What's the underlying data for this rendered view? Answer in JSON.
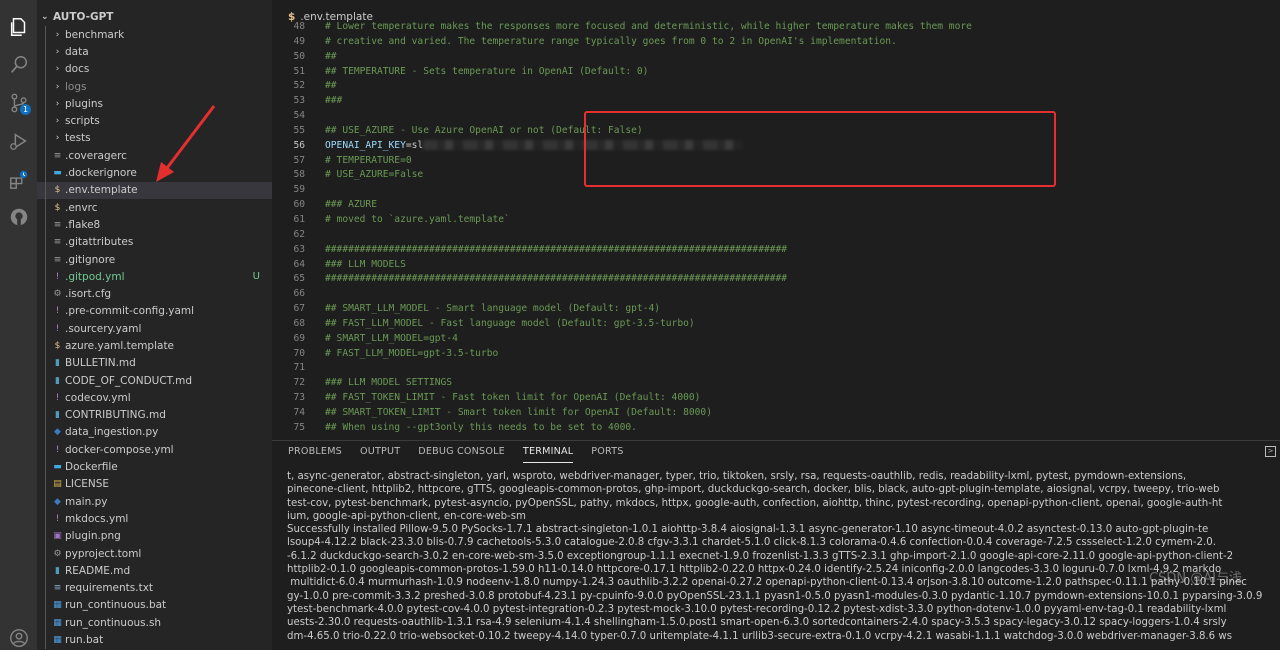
{
  "explorer": {
    "root": "AUTO-GPT",
    "items": [
      {
        "name": "benchmark",
        "type": "folder"
      },
      {
        "name": "data",
        "type": "folder"
      },
      {
        "name": "docs",
        "type": "folder"
      },
      {
        "name": "logs",
        "type": "folder-dim"
      },
      {
        "name": "plugins",
        "type": "folder"
      },
      {
        "name": "scripts",
        "type": "folder"
      },
      {
        "name": "tests",
        "type": "folder"
      },
      {
        "name": ".coveragerc",
        "type": "file"
      },
      {
        "name": ".dockerignore",
        "type": "file"
      },
      {
        "name": ".env.template",
        "type": "file"
      },
      {
        "name": ".envrc",
        "type": "file"
      },
      {
        "name": ".flake8",
        "type": "file"
      },
      {
        "name": ".gitattributes",
        "type": "file"
      },
      {
        "name": ".gitignore",
        "type": "file"
      },
      {
        "name": ".gitpod.yml",
        "type": "file",
        "git_status": "U"
      },
      {
        "name": ".isort.cfg",
        "type": "file"
      },
      {
        "name": ".pre-commit-config.yaml",
        "type": "file"
      },
      {
        "name": ".sourcery.yaml",
        "type": "file"
      },
      {
        "name": "azure.yaml.template",
        "type": "file"
      },
      {
        "name": "BULLETIN.md",
        "type": "file"
      },
      {
        "name": "CODE_OF_CONDUCT.md",
        "type": "file"
      },
      {
        "name": "codecov.yml",
        "type": "file"
      },
      {
        "name": "CONTRIBUTING.md",
        "type": "file"
      },
      {
        "name": "data_ingestion.py",
        "type": "file"
      },
      {
        "name": "docker-compose.yml",
        "type": "file"
      },
      {
        "name": "Dockerfile",
        "type": "file"
      },
      {
        "name": "LICENSE",
        "type": "file"
      },
      {
        "name": "main.py",
        "type": "file"
      },
      {
        "name": "mkdocs.yml",
        "type": "file"
      },
      {
        "name": "plugin.png",
        "type": "file"
      },
      {
        "name": "pyproject.toml",
        "type": "file"
      },
      {
        "name": "README.md",
        "type": "file"
      },
      {
        "name": "requirements.txt",
        "type": "file"
      },
      {
        "name": "run_continuous.bat",
        "type": "file"
      },
      {
        "name": "run_continuous.sh",
        "type": "file"
      },
      {
        "name": "run.bat",
        "type": "file"
      }
    ],
    "selected": ".env.template"
  },
  "activity": {
    "source_control_badge": "1"
  },
  "editor": {
    "breadcrumb_icon": "$",
    "breadcrumb": ".env.template",
    "active_line": "56",
    "lines": [
      {
        "n": "48",
        "text": "# Lower temperature makes the responses more focused and deterministic, while higher temperature makes them more",
        "kind": "comment"
      },
      {
        "n": "49",
        "text": "# creative and varied. The temperature range typically goes from 0 to 2 in OpenAI's implementation.",
        "kind": "comment"
      },
      {
        "n": "50",
        "text": "##",
        "kind": "comment"
      },
      {
        "n": "51",
        "text": "## TEMPERATURE - Sets temperature in OpenAI (Default: 0)",
        "kind": "comment"
      },
      {
        "n": "52",
        "text": "##",
        "kind": "comment"
      },
      {
        "n": "53",
        "text": "###",
        "kind": "comment"
      },
      {
        "n": "54",
        "text": "",
        "kind": "blank"
      },
      {
        "n": "55",
        "text": "## USE_AZURE - Use Azure OpenAI or not (Default: False)",
        "kind": "comment"
      },
      {
        "n": "56",
        "key": "OPENAI_API_KEY",
        "eq": "=",
        "value": "sl",
        "kind": "assign"
      },
      {
        "n": "57",
        "text": "# TEMPERATURE=0",
        "kind": "comment"
      },
      {
        "n": "58",
        "text": "# USE_AZURE=False",
        "kind": "comment"
      },
      {
        "n": "59",
        "text": "",
        "kind": "blank"
      },
      {
        "n": "60",
        "text": "### AZURE",
        "kind": "comment"
      },
      {
        "n": "61",
        "text": "# moved to `azure.yaml.template`",
        "kind": "comment"
      },
      {
        "n": "62",
        "text": "",
        "kind": "blank"
      },
      {
        "n": "63",
        "text": "################################################################################",
        "kind": "comment"
      },
      {
        "n": "64",
        "text": "### LLM MODELS",
        "kind": "comment"
      },
      {
        "n": "65",
        "text": "################################################################################",
        "kind": "comment"
      },
      {
        "n": "66",
        "text": "",
        "kind": "blank"
      },
      {
        "n": "67",
        "text": "## SMART_LLM_MODEL - Smart language model (Default: gpt-4)",
        "kind": "comment"
      },
      {
        "n": "68",
        "text": "## FAST_LLM_MODEL - Fast language model (Default: gpt-3.5-turbo)",
        "kind": "comment"
      },
      {
        "n": "69",
        "text": "# SMART_LLM_MODEL=gpt-4",
        "kind": "comment"
      },
      {
        "n": "70",
        "text": "# FAST_LLM_MODEL=gpt-3.5-turbo",
        "kind": "comment"
      },
      {
        "n": "71",
        "text": "",
        "kind": "blank"
      },
      {
        "n": "72",
        "text": "### LLM MODEL SETTINGS",
        "kind": "comment"
      },
      {
        "n": "73",
        "text": "## FAST_TOKEN_LIMIT - Fast token limit for OpenAI (Default: 4000)",
        "kind": "comment"
      },
      {
        "n": "74",
        "text": "## SMART_TOKEN_LIMIT - Smart token limit for OpenAI (Default: 8000)",
        "kind": "comment"
      },
      {
        "n": "75",
        "text": "## When using --gpt3only this needs to be set to 4000.",
        "kind": "comment"
      }
    ]
  },
  "panel": {
    "tabs": [
      "PROBLEMS",
      "OUTPUT",
      "DEBUG CONSOLE",
      "TERMINAL",
      "PORTS"
    ],
    "active_tab": "TERMINAL",
    "terminal_lines": [
      "t, async-generator, abstract-singleton, yarl, wsproto, webdriver-manager, typer, trio, tiktoken, srsly, rsa, requests-oauthlib, redis, readability-lxml, pytest, pymdown-extensions, ",
      "pinecone-client, httplib2, httpcore, gTTS, googleapis-common-protos, ghp-import, duckduckgo-search, docker, blis, black, auto-gpt-plugin-template, aiosignal, vcrpy, tweepy, trio-web",
      "test-cov, pytest-benchmark, pytest-asyncio, pyOpenSSL, pathy, mkdocs, httpx, google-auth, confection, aiohttp, thinc, pytest-recording, openapi-python-client, openai, google-auth-ht",
      "ium, google-api-python-client, en-core-web-sm",
      "Successfully installed Pillow-9.5.0 PySocks-1.7.1 abstract-singleton-1.0.1 aiohttp-3.8.4 aiosignal-1.3.1 async-generator-1.10 async-timeout-4.0.2 asynctest-0.13.0 auto-gpt-plugin-te",
      "lsoup4-4.12.2 black-23.3.0 blis-0.7.9 cachetools-5.3.0 catalogue-2.0.8 cfgv-3.3.1 chardet-5.1.0 click-8.1.3 colorama-0.4.6 confection-0.0.4 coverage-7.2.5 cssselect-1.2.0 cymem-2.0.",
      "-6.1.2 duckduckgo-search-3.0.2 en-core-web-sm-3.5.0 exceptiongroup-1.1.1 execnet-1.9.0 frozenlist-1.3.3 gTTS-2.3.1 ghp-import-2.1.0 google-api-core-2.11.0 google-api-python-client-2",
      "httplib2-0.1.0 googleapis-common-protos-1.59.0 h11-0.14.0 httpcore-0.17.1 httplib2-0.22.0 httpx-0.24.0 identify-2.5.24 iniconfig-2.0.0 langcodes-3.3.0 loguru-0.7.0 lxml-4.9.2 markdo",
      " multidict-6.0.4 murmurhash-1.0.9 nodeenv-1.8.0 numpy-1.24.3 oauthlib-3.2.2 openai-0.27.2 openapi-python-client-0.13.4 orjson-3.8.10 outcome-1.2.0 pathspec-0.11.1 pathy-0.10.1 pinec",
      "gy-1.0.0 pre-commit-3.3.2 preshed-3.0.8 protobuf-4.23.1 py-cpuinfo-9.0.0 pyOpenSSL-23.1.1 pyasn1-0.5.0 pyasn1-modules-0.3.0 pydantic-1.10.7 pymdown-extensions-10.0.1 pyparsing-3.0.9",
      "ytest-benchmark-4.0.0 pytest-cov-4.0.0 pytest-integration-0.2.3 pytest-mock-3.10.0 pytest-recording-0.12.2 pytest-xdist-3.3.0 python-dotenv-1.0.0 pyyaml-env-tag-0.1 readability-lxml",
      "uests-2.30.0 requests-oauthlib-1.3.1 rsa-4.9 selenium-4.1.4 shellingham-1.5.0.post1 smart-open-6.3.0 sortedcontainers-2.4.0 spacy-3.5.3 spacy-legacy-3.0.12 spacy-loggers-1.0.4 srsly",
      "dm-4.65.0 trio-0.22.0 trio-websocket-0.10.2 tweepy-4.14.0 typer-0.7.0 uritemplate-4.1.1 urllib3-secure-extra-0.1.0 vcrpy-4.2.1 wasabi-1.1.1 watchdog-3.0.0 webdriver-manager-3.8.6 ws"
    ],
    "maximize_icon": ">",
    "watermark": "CSDN @AI与浅"
  },
  "colors": {
    "highlight_box": "#e52f2f",
    "arrow": "#e52f2f",
    "comment": "#6a9955",
    "variable": "#9cdcfe"
  }
}
